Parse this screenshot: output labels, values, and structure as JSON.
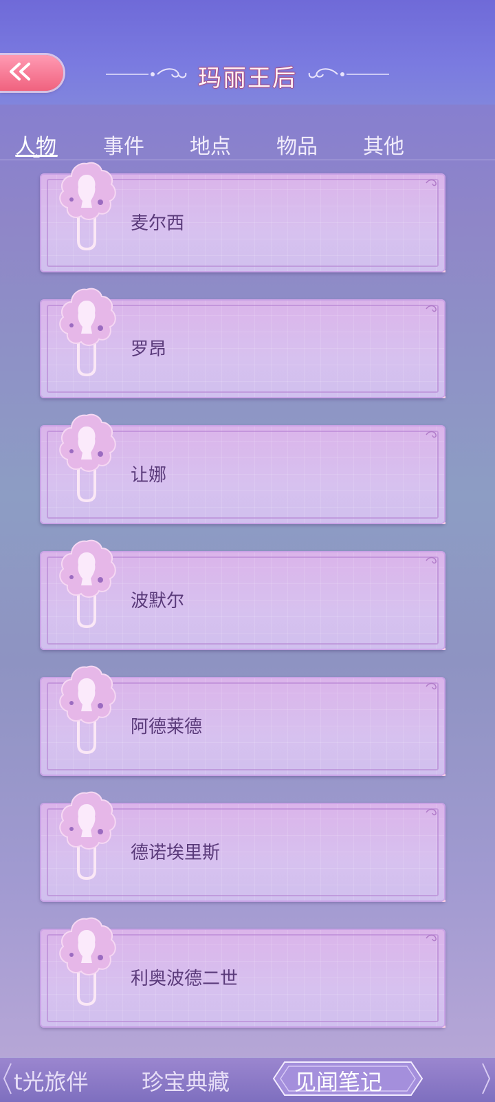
{
  "header": {
    "back_label": "«",
    "title": "玛丽王后"
  },
  "tabs": [
    {
      "label": "人物",
      "active": true
    },
    {
      "label": "事件",
      "active": false
    },
    {
      "label": "地点",
      "active": false
    },
    {
      "label": "物品",
      "active": false
    },
    {
      "label": "其他",
      "active": false
    }
  ],
  "cards": [
    {
      "name": "麦尔西"
    },
    {
      "name": "罗昂"
    },
    {
      "name": "让娜"
    },
    {
      "name": "波默尔"
    },
    {
      "name": "阿德莱德"
    },
    {
      "name": "德诺埃里斯"
    },
    {
      "name": "利奥波德二世"
    }
  ],
  "bottom_nav": [
    {
      "label": "时光旅伴",
      "visible_label": "t光旅伴",
      "active": false
    },
    {
      "label": "珍宝典藏",
      "active": false
    },
    {
      "label": "见闻笔记",
      "active": true
    }
  ],
  "colors": {
    "accent_pink": "#f0627f",
    "card_text": "#5a3a7a",
    "title_outline": "#a84d84"
  }
}
